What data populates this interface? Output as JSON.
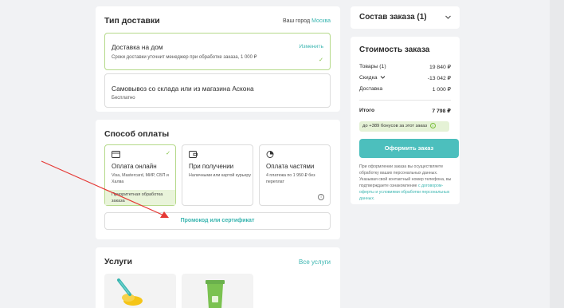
{
  "delivery": {
    "title": "Тип доставки",
    "city_label": "Ваш город",
    "city": "Москва",
    "options": [
      {
        "title": "Доставка на дом",
        "subtitle": "Сроки доставки уточнит менеджер при обработке заказа, 1 000 ₽",
        "action": "Изменить"
      },
      {
        "title": "Самовывоз со склада или из магазина Аскона",
        "subtitle": "Бесплатно"
      }
    ]
  },
  "payment": {
    "title": "Способ оплаты",
    "options": [
      {
        "title": "Оплата онлайн",
        "subtitle": "Visa, Mastercard, МИР, СБП и Халва",
        "banner": "Приоритетная обработка заказа"
      },
      {
        "title": "При получении",
        "subtitle": "Наличными или картой курьеру"
      },
      {
        "title": "Оплата частями",
        "subtitle": "4 платежа по 1 950 ₽ без переплат"
      }
    ],
    "promo_label": "Промокод или сертификат"
  },
  "services": {
    "title": "Услуги",
    "all_link": "Все услуги"
  },
  "order": {
    "composition_title": "Состав заказа (1)",
    "cost_title": "Стоимость заказа",
    "rows": [
      {
        "label": "Товары (1)",
        "value": "19 840 ₽"
      },
      {
        "label": "Скидка",
        "value": "-13 042 ₽"
      },
      {
        "label": "Доставка",
        "value": "1 000 ₽"
      }
    ],
    "total_label": "Итого",
    "total_value": "7 798 ₽",
    "bonus": "до +389 бонусов за этот заказ",
    "button": "Оформить заказ",
    "legal_text": "При оформлении заказа вы осуществляете обработку ваших персональных данных. Указывая свой контактный номер телефона, вы подтверждаете ознакомление",
    "legal_link": "с договором-оферты и условиями обработки персональных данных."
  },
  "colors": {
    "accent": "#4cbfbd",
    "selected_border": "#b5d98a",
    "arrow": "#e53935"
  }
}
